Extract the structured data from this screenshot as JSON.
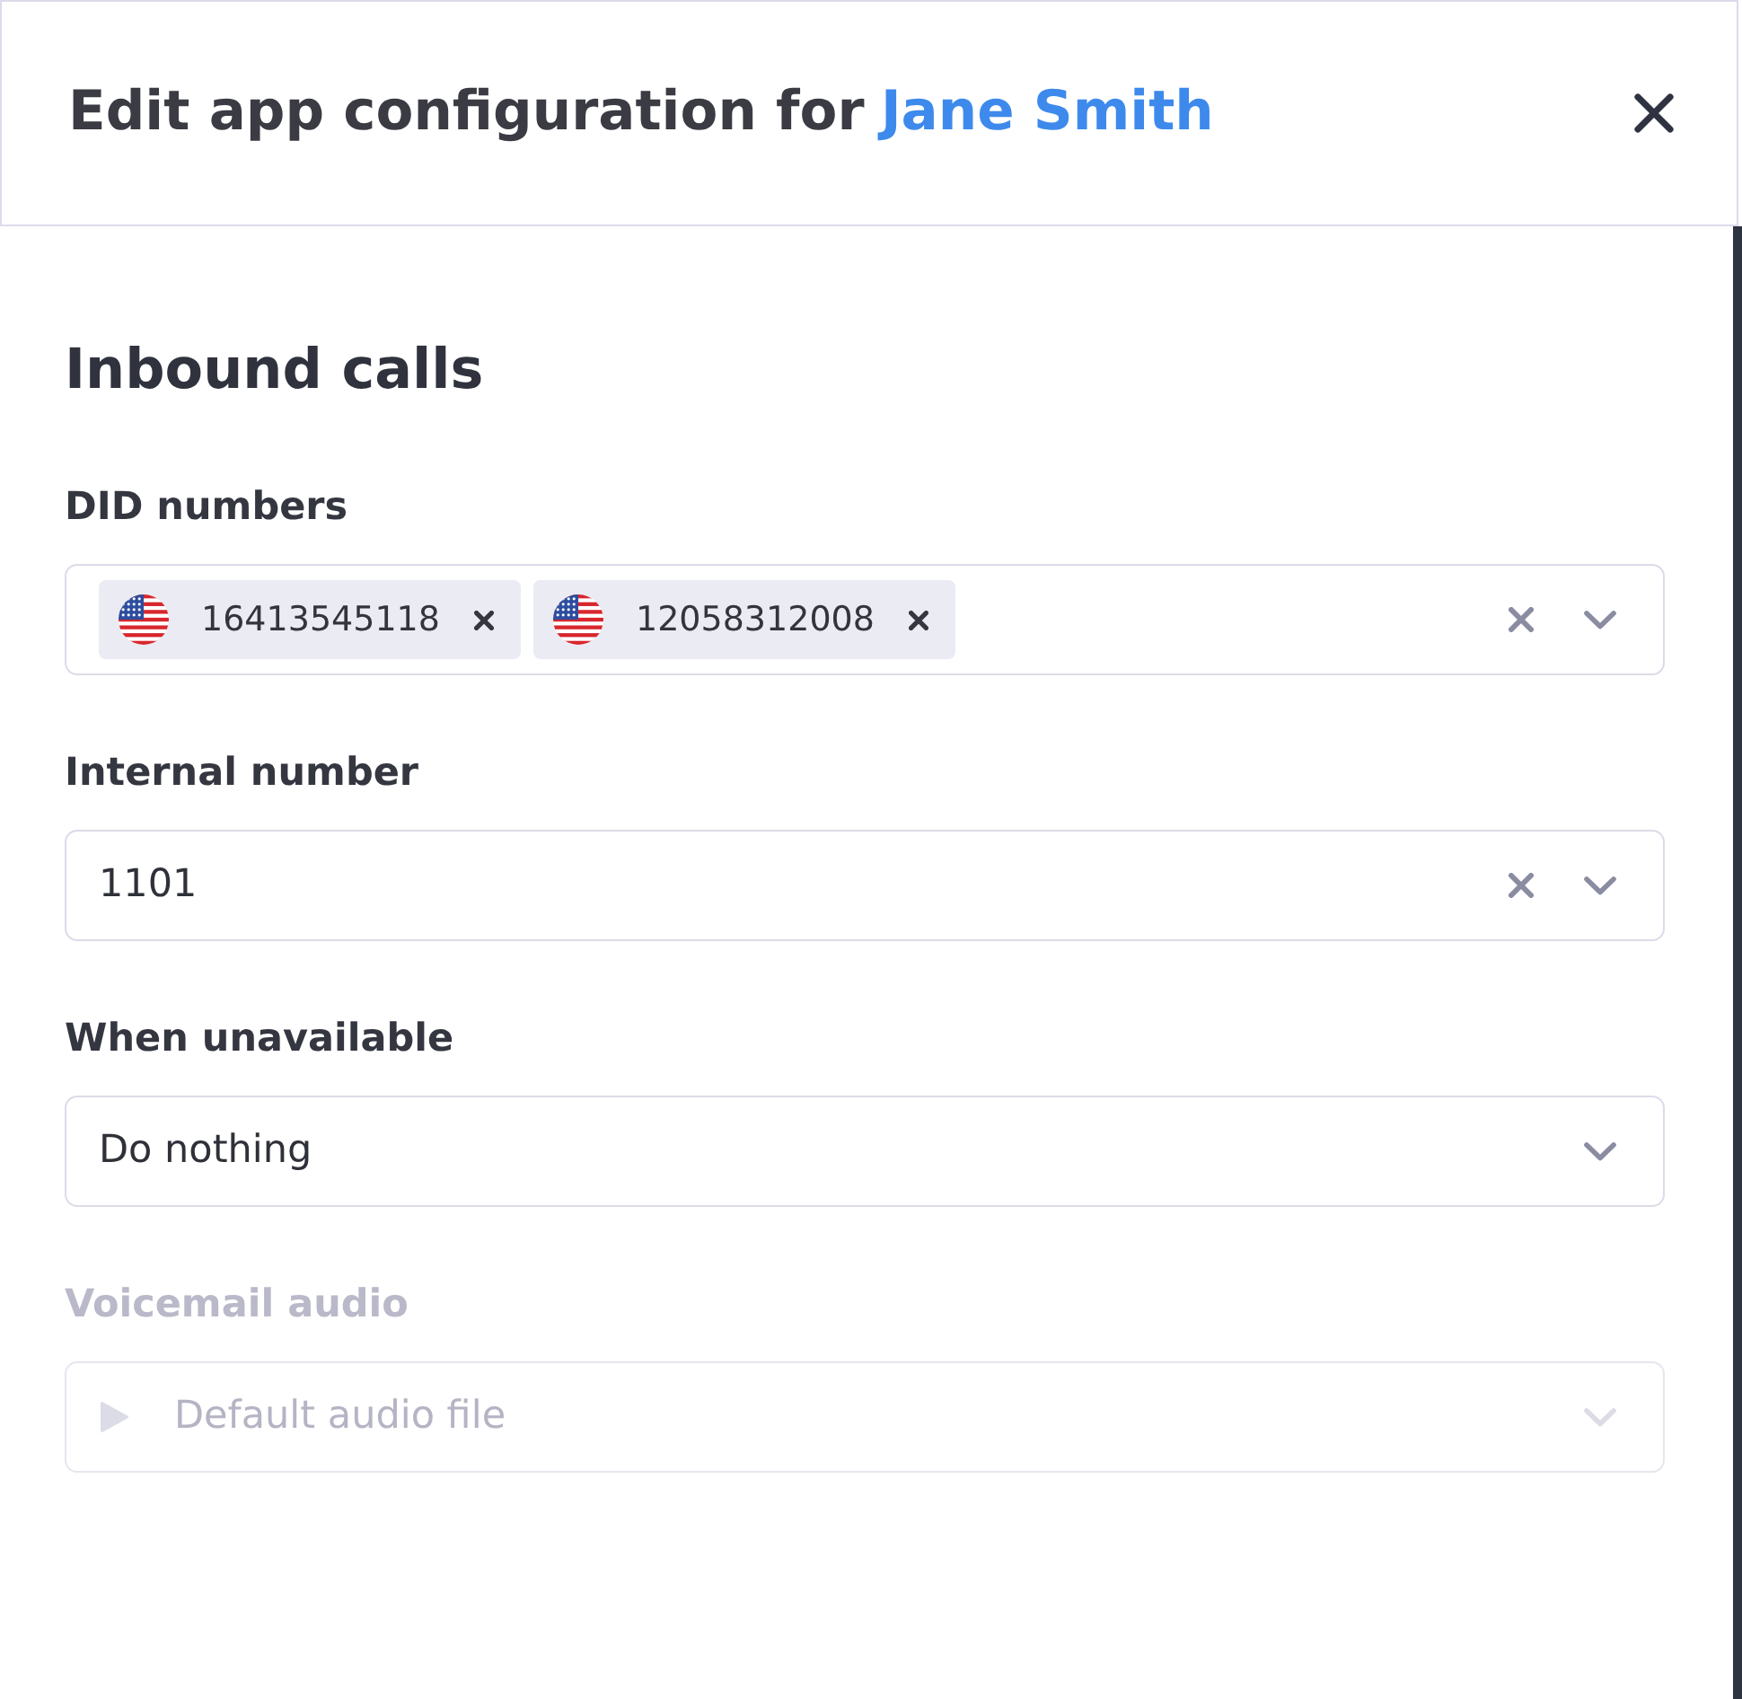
{
  "header": {
    "title": "Edit app configuration for",
    "subject": "Jane Smith"
  },
  "section": {
    "heading": "Inbound calls",
    "fields": [
      {
        "kind": "multi_select",
        "label": "DID numbers",
        "disabled": false,
        "clearable": true,
        "chips": [
          {
            "value": "16413545118"
          },
          {
            "value": "12058312008"
          }
        ]
      },
      {
        "kind": "select",
        "label": "Internal number",
        "disabled": false,
        "clearable": true,
        "value": "1101"
      },
      {
        "kind": "select",
        "label": "When unavailable",
        "disabled": false,
        "clearable": false,
        "value": "Do nothing"
      },
      {
        "kind": "audio_select",
        "label": "Voicemail audio",
        "disabled": true,
        "clearable": false,
        "value": "Default audio file"
      }
    ]
  }
}
